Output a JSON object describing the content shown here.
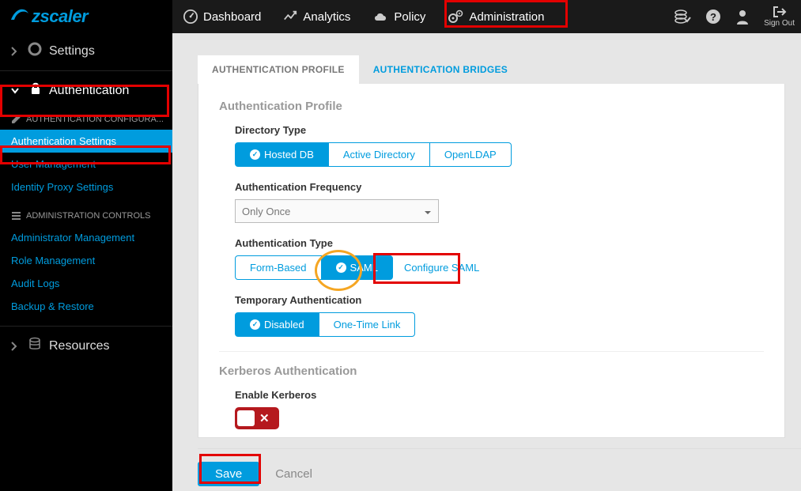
{
  "brand": "zscaler",
  "topnav": [
    {
      "label": "Dashboard",
      "icon": "dashboard"
    },
    {
      "label": "Analytics",
      "icon": "analytics"
    },
    {
      "label": "Policy",
      "icon": "policy"
    },
    {
      "label": "Administration",
      "icon": "administration"
    }
  ],
  "signout_label": "Sign Out",
  "sidebar": {
    "settings_label": "Settings",
    "authentication_label": "Authentication",
    "auth_config_header": "AUTHENTICATION CONFIGURA...",
    "auth_links": [
      "Authentication Settings",
      "User Management",
      "Identity Proxy Settings"
    ],
    "admin_controls_header": "ADMINISTRATION CONTROLS",
    "admin_links": [
      "Administrator Management",
      "Role Management",
      "Audit Logs",
      "Backup & Restore"
    ],
    "resources_label": "Resources"
  },
  "tabs": {
    "profile": "AUTHENTICATION PROFILE",
    "bridges": "AUTHENTICATION BRIDGES"
  },
  "panel": {
    "title": "Authentication Profile",
    "directory_type": {
      "label": "Directory Type",
      "options": [
        "Hosted DB",
        "Active Directory",
        "OpenLDAP"
      ],
      "selected": "Hosted DB"
    },
    "auth_frequency": {
      "label": "Authentication Frequency",
      "value": "Only Once"
    },
    "auth_type": {
      "label": "Authentication Type",
      "options": [
        "Form-Based",
        "SAML"
      ],
      "selected": "SAML",
      "configure_link": "Configure SAML"
    },
    "temp_auth": {
      "label": "Temporary Authentication",
      "options": [
        "Disabled",
        "One-Time Link"
      ],
      "selected": "Disabled"
    },
    "kerberos": {
      "section": "Kerberos Authentication",
      "label": "Enable Kerberos",
      "enabled": false
    }
  },
  "footer": {
    "save": "Save",
    "cancel": "Cancel"
  }
}
